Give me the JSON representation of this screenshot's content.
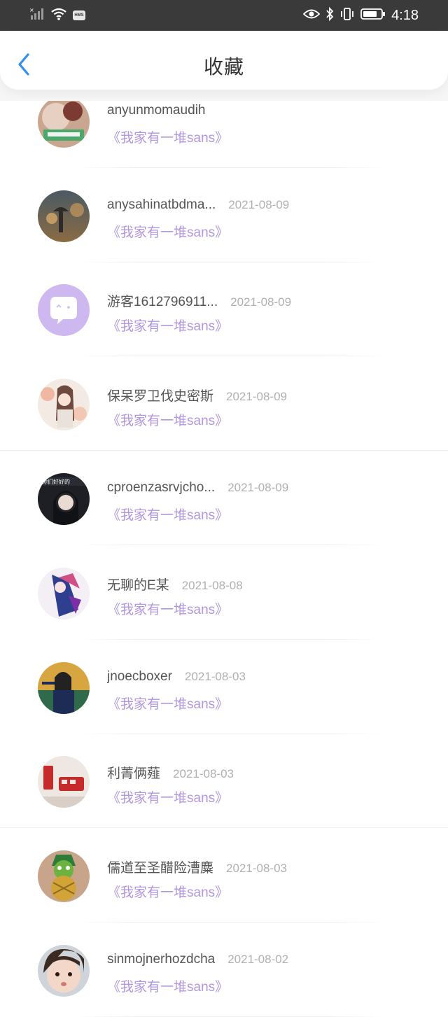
{
  "status_bar": {
    "time": "4:18",
    "hms_label": "HMS"
  },
  "header": {
    "title": "收藏"
  },
  "items": [
    {
      "name": "anyunmomaudih",
      "date": "",
      "book": "《我家有一堆sans》",
      "avatar": "photo-food"
    },
    {
      "name": "anysahinatbdma...",
      "date": "2021-08-09",
      "book": "《我家有一堆sans》",
      "avatar": "photo-rain-street"
    },
    {
      "name": "游客1612796911...",
      "date": "2021-08-09",
      "book": "《我家有一堆sans》",
      "avatar": "default-chat-avatar"
    },
    {
      "name": "保呆罗卫伐史密斯",
      "date": "2021-08-09",
      "book": "《我家有一堆sans》",
      "avatar": "photo-anime-girl-flowers"
    },
    {
      "name": "cproenzasrvjcho...",
      "date": "2021-08-09",
      "book": "《我家有一堆sans》",
      "avatar": "photo-girl-dark"
    },
    {
      "name": "无聊的E某",
      "date": "2021-08-08",
      "book": "《我家有一堆sans》",
      "avatar": "photo-anime-colorful"
    },
    {
      "name": "jnoecboxer",
      "date": "2021-08-03",
      "book": "《我家有一堆sans》",
      "avatar": "photo-girl-outdoor"
    },
    {
      "name": "利菁俩薤",
      "date": "2021-08-03",
      "book": "《我家有一堆sans》",
      "avatar": "photo-red-bus"
    },
    {
      "name": "儒道至圣醋险漕麋",
      "date": "2021-08-03",
      "book": "《我家有一堆sans》",
      "avatar": "photo-pineapple-bird"
    },
    {
      "name": "sinmojnerhozdcha",
      "date": "2021-08-02",
      "book": "《我家有一堆sans》",
      "avatar": "photo-child-face"
    }
  ],
  "colors": {
    "accent_blue": "#2f8ff0",
    "book_purple": "#b296de",
    "status_bar": "#3a3a3a"
  }
}
